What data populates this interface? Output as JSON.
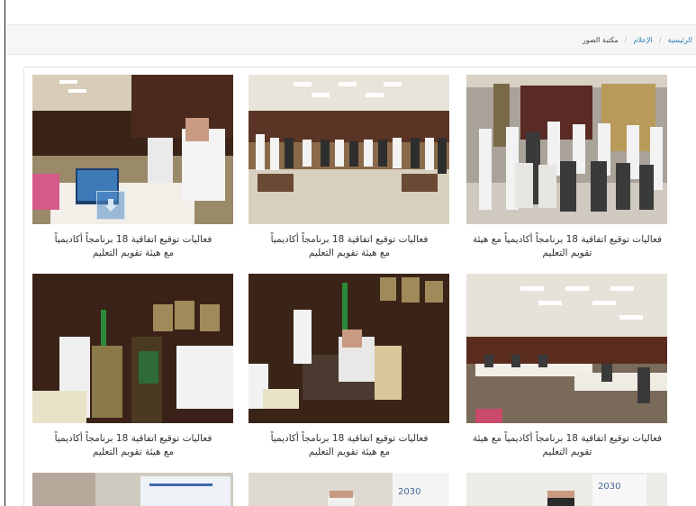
{
  "breadcrumb": {
    "home": "الرئيسية",
    "section": "الإعلام",
    "current": "مكتبة الصور",
    "separator": "/"
  },
  "gallery": {
    "items": [
      {
        "line1": "فعاليات توقيع اتفاقية 18 برنامجاً أكاديمياً مع هيئة",
        "line2": "تقويم التعليم"
      },
      {
        "line1": "فعاليات توقيع اتفاقية 18 برنامجاً أكاديمياً",
        "line2": "مع هيئة تقويم التعليم"
      },
      {
        "line1": "فعاليات توقيع اتفاقية 18 برنامجاً أكاديمياً",
        "line2": "مع هيئة تقويم التعليم"
      },
      {
        "line1": "فعاليات توقيع اتفاقية 18 برنامجاً أكاديمياً مع هيئة",
        "line2": "تقويم التعليم"
      },
      {
        "line1": "فعاليات توقيع اتفاقية 18 برنامجاً أكاديمياً",
        "line2": "مع هيئة تقويم التعليم"
      },
      {
        "line1": "فعاليات توقيع اتفاقية 18 برنامجاً أكاديمياً",
        "line2": "مع هيئة تقويم التعليم"
      }
    ],
    "partial_items": [
      {
        "badge": "2030"
      },
      {
        "badge": "2030"
      }
    ]
  },
  "colors": {
    "link": "#2c7fb8",
    "wood": "#4a2a1a",
    "wall": "#b8b2a8"
  }
}
